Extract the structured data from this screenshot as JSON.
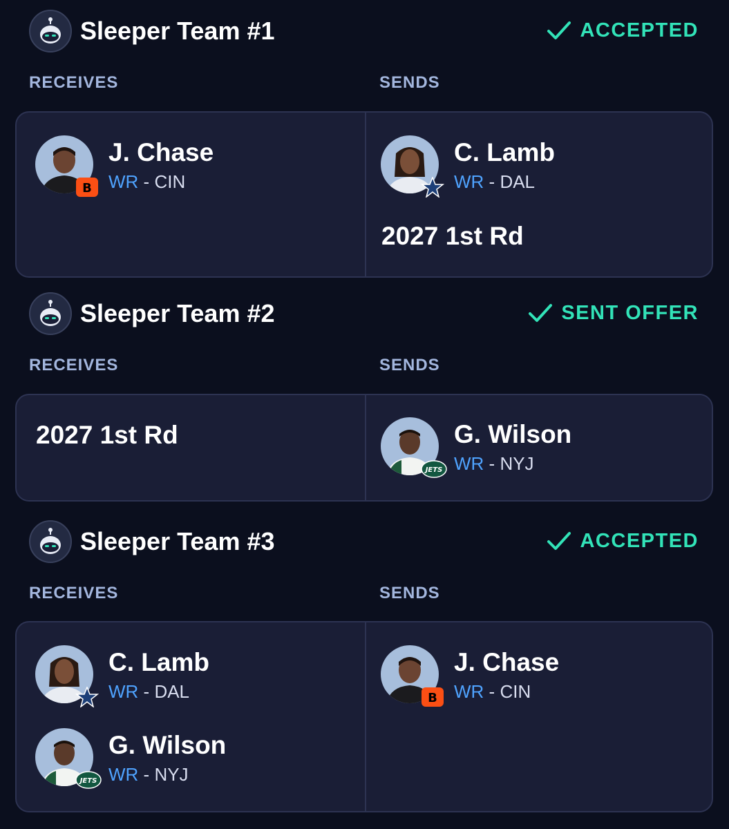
{
  "labels": {
    "receives": "RECEIVES",
    "sends": "SENDS",
    "separator": " - "
  },
  "colors": {
    "background": "#0b0f1e",
    "card": "#1a1e36",
    "accent": "#32e3b8",
    "position": "#4fa3ff",
    "label": "#a3b6de"
  },
  "trades": [
    {
      "team": "Sleeper Team #1",
      "status": "ACCEPTED",
      "status_icon": "check-icon",
      "receives": {
        "players": [
          {
            "name": "J. Chase",
            "pos": "WR",
            "team": "CIN",
            "logo": "bengals-logo-icon"
          }
        ],
        "picks": []
      },
      "sends": {
        "players": [
          {
            "name": "C. Lamb",
            "pos": "WR",
            "team": "DAL",
            "logo": "cowboys-star-icon"
          }
        ],
        "picks": [
          "2027 1st Rd"
        ]
      }
    },
    {
      "team": "Sleeper Team #2",
      "status": "SENT OFFER",
      "status_icon": "check-icon",
      "receives": {
        "players": [],
        "picks": [
          "2027 1st Rd"
        ]
      },
      "sends": {
        "players": [
          {
            "name": "G. Wilson",
            "pos": "WR",
            "team": "NYJ",
            "logo": "jets-logo-icon"
          }
        ],
        "picks": []
      }
    },
    {
      "team": "Sleeper Team #3",
      "status": "ACCEPTED",
      "status_icon": "check-icon",
      "receives": {
        "players": [
          {
            "name": "C. Lamb",
            "pos": "WR",
            "team": "DAL",
            "logo": "cowboys-star-icon"
          },
          {
            "name": "G. Wilson",
            "pos": "WR",
            "team": "NYJ",
            "logo": "jets-logo-icon"
          }
        ],
        "picks": []
      },
      "sends": {
        "players": [
          {
            "name": "J. Chase",
            "pos": "WR",
            "team": "CIN",
            "logo": "bengals-logo-icon"
          }
        ],
        "picks": []
      }
    }
  ]
}
